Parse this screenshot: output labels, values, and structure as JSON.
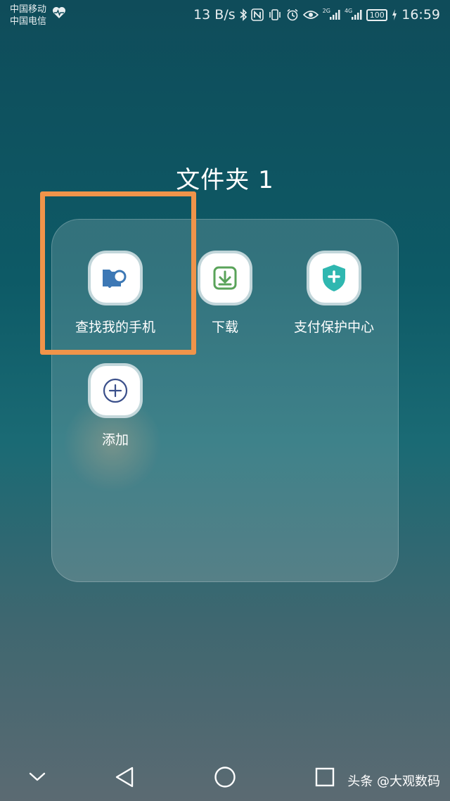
{
  "status_bar": {
    "carrier_1": "中国移动",
    "carrier_2": "中国电信",
    "net_speed": "13 B/s",
    "signal_1_label": "2G",
    "signal_2_label": "4G",
    "battery": "100",
    "time": "16:59"
  },
  "folder": {
    "title": "文件夹 1",
    "apps": [
      {
        "label": "查找我的手机",
        "icon": "find-phone-icon",
        "color": "#3d78b5"
      },
      {
        "label": "下载",
        "icon": "download-icon",
        "color": "#5aa35a"
      },
      {
        "label": "支付保护中心",
        "icon": "shield-plus-icon",
        "color": "#2fb7b0"
      },
      {
        "label": "添加",
        "icon": "add-icon",
        "color": "#3a4f8a"
      }
    ]
  },
  "highlight_color": "#f0944a",
  "nav_bar": {
    "buttons": [
      "collapse-icon",
      "back-icon",
      "home-icon",
      "recents-icon"
    ]
  },
  "watermark": "头条 @大观数码"
}
